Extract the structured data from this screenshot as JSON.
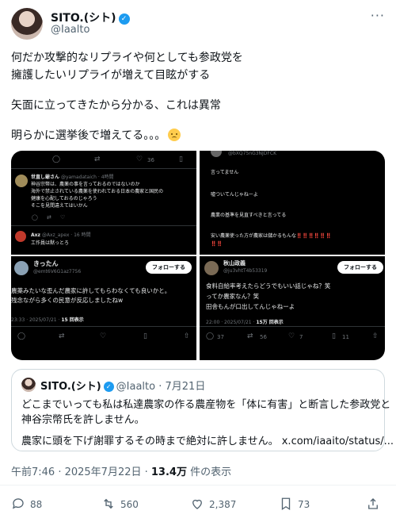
{
  "author": {
    "name": "SITO.(シト)",
    "handle": "@Iaalto"
  },
  "tweet": {
    "lines": [
      "何だか攻撃的なリプライや何としても参政党を",
      "擁護したいリプライが増えて目眩がする",
      "矢面に立ってきたから分かる、これは異常",
      "明らかに選挙後で増えてる。。。"
    ]
  },
  "media": {
    "top_left": {
      "count": "36",
      "reply1_name": "世直し爺さん",
      "reply1_handle": "@yamadataich · 4時間",
      "reply1_lines": [
        "神谷宗幣は、農薬の事を言っておるのではないのか",
        "海外で禁止されている農薬を使われておる日本の農家と国民の",
        "健康を心配しておるのじゃろう",
        "そこを見間違えてはいかん"
      ],
      "reply2_name": "Axz",
      "reply2_handle": "@Axz_apex · 16 時間",
      "reply2_text": "工作員は黙っとろ"
    },
    "top_right": {
      "handle": "@bXQ75nG3NJDFCK",
      "lines": [
        "言ってません",
        "嘘ついてんじゃねーよ",
        "農業の基準を見直すべきと言ってる",
        "安い農薬使った方が農家は儲かるもんな‼️‼️‼️‼️‼️‼️",
        "‼️‼️"
      ]
    },
    "bottom_left": {
      "name": "きったん",
      "handle": "@emt6V6G1az7756",
      "follow": "フォローする",
      "lines": [
        "農薬みたいな歪んだ農家に許してもらわなくても良いかと。",
        "残念ながら多くの民意が反応しましたねw"
      ],
      "timestamp": "23:33 · 2025/07/21 · ",
      "views": "15 回表示"
    },
    "bottom_right": {
      "name": "秋山政義",
      "handle": "@ju3vhtT4b53319",
      "follow": "フォローする",
      "lines": [
        "食料自給率考えたらどうでもいい話じゃね？笑",
        "ってか農家なん？笑",
        "田舎もんが口出してんじゃねーよ"
      ],
      "timestamp": "22:00 · 2025/07/21 · ",
      "views": "15万 回表示",
      "replies": "37",
      "reposts": "56",
      "likes": "7",
      "bookmarks": "11"
    }
  },
  "quote": {
    "name": "SITO.(シト)",
    "handle": "@Iaalto",
    "date": "7月21日",
    "lines": [
      "どこまでいっても私は私達農家の作る農産物を「体に有害」と断言した参政党と",
      "神谷宗幣氏を許しません。",
      "農家に頭を下げ謝罪するその時まで絶対に許しません。 x.com/iaaito/status/..."
    ]
  },
  "meta": {
    "time": "午前7:46 · 2025年7月22日 · ",
    "views": "13.4万",
    "views_label": " 件の表示"
  },
  "actions": {
    "replies": "88",
    "reposts": "560",
    "likes": "2,387",
    "bookmarks": "73"
  }
}
